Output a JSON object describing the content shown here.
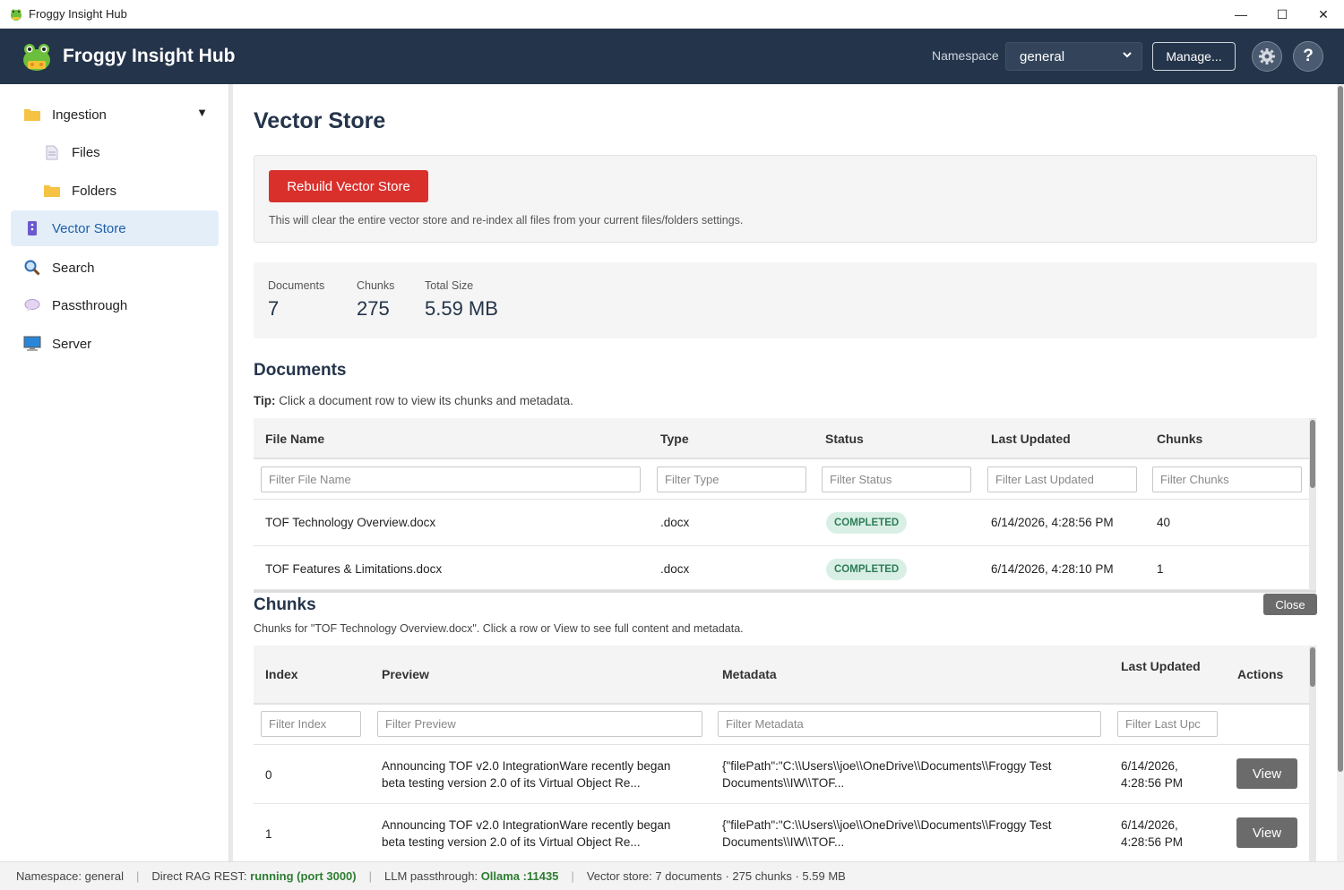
{
  "window": {
    "title": "Froggy Insight Hub",
    "minimize": "—",
    "maximize": "☐",
    "close": "✕"
  },
  "header": {
    "brand": "Froggy Insight Hub",
    "namespace_label": "Namespace",
    "namespace_value": "general",
    "manage_label": "Manage...",
    "help_label": "?"
  },
  "sidebar": {
    "items": [
      {
        "label": "Ingestion",
        "icon": "folder-icon"
      },
      {
        "label": "Files",
        "icon": "file-icon"
      },
      {
        "label": "Folders",
        "icon": "folder-icon"
      },
      {
        "label": "Vector Store",
        "icon": "database-icon"
      },
      {
        "label": "Search",
        "icon": "search-icon"
      },
      {
        "label": "Passthrough",
        "icon": "chat-bubble-icon"
      },
      {
        "label": "Server",
        "icon": "monitor-icon"
      }
    ]
  },
  "main": {
    "title": "Vector Store",
    "rebuild_label": "Rebuild Vector Store",
    "rebuild_desc": "This will clear the entire vector store and re-index all files from your current files/folders settings.",
    "stats": [
      {
        "label": "Documents",
        "value": "7"
      },
      {
        "label": "Chunks",
        "value": "275"
      },
      {
        "label": "Total Size",
        "value": "5.59 MB"
      }
    ],
    "documents_title": "Documents",
    "tip_bold": "Tip:",
    "tip_text": " Click a document row to view its chunks and metadata.",
    "documents": {
      "columns": [
        "File Name",
        "Type",
        "Status",
        "Last Updated",
        "Chunks"
      ],
      "filters": [
        "Filter File Name",
        "Filter Type",
        "Filter Status",
        "Filter Last Updated",
        "Filter Chunks"
      ],
      "rows": [
        {
          "file": "TOF Technology Overview.docx",
          "type": ".docx",
          "status": "COMPLETED",
          "updated": "6/14/2026, 4:28:56 PM",
          "chunks": "40"
        },
        {
          "file": "TOF Features & Limitations.docx",
          "type": ".docx",
          "status": "COMPLETED",
          "updated": "6/14/2026, 4:28:10 PM",
          "chunks": "1"
        }
      ]
    },
    "chunks_title": "Chunks",
    "close_label": "Close",
    "chunks_desc": "Chunks for \"TOF Technology Overview.docx\". Click a row or View to see full content and metadata.",
    "chunks": {
      "columns": [
        "Index",
        "Preview",
        "Metadata",
        "Last Updated",
        "Actions"
      ],
      "filters": [
        "Filter Index",
        "Filter Preview",
        "Filter Metadata",
        "Filter Last Upc"
      ],
      "rows": [
        {
          "index": "0",
          "preview_1": "Announcing TOF v2.0 IntegrationWare recently began",
          "preview_2": "beta testing version 2.0 of its Virtual Object Re...",
          "meta_1": "{\"filePath\":\"C:\\\\Users\\\\joe\\\\OneDrive\\\\Documents\\\\Froggy Test",
          "meta_2": "Documents\\\\IW\\\\TOF...",
          "updated_1": "6/14/2026,",
          "updated_2": "4:28:56 PM",
          "action": "View"
        },
        {
          "index": "1",
          "preview_1": "Announcing TOF v2.0 IntegrationWare recently began",
          "preview_2": "beta testing version 2.0 of its Virtual Object Re...",
          "meta_1": "{\"filePath\":\"C:\\\\Users\\\\joe\\\\OneDrive\\\\Documents\\\\Froggy Test",
          "meta_2": "Documents\\\\IW\\\\TOF...",
          "updated_1": "6/14/2026,",
          "updated_2": "4:28:56 PM",
          "action": "View"
        }
      ]
    }
  },
  "statusbar": {
    "namespace": "Namespace: general",
    "rag_label": "Direct RAG REST: ",
    "rag_value": "running (port 3000)",
    "llm_label": "LLM passthrough: ",
    "llm_value": "Ollama :11435",
    "vector": "Vector store: 7 documents · 275 chunks · 5.59 MB",
    "separator": "|"
  },
  "colors": {
    "header_bg": "#24344a",
    "accent": "#1f5fa8",
    "danger": "#d9302c",
    "success": "#2e7d57"
  }
}
